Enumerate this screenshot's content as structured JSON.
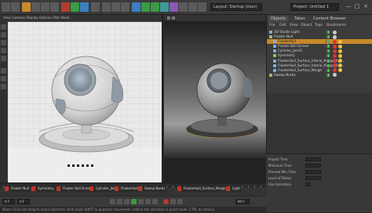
{
  "toolbar": {
    "layout_label": "Layout:",
    "layout_value": "Startup (User)",
    "project_label": "Project:",
    "project_value": "Untitled 1",
    "window_controls": [
      "—",
      "□",
      "×"
    ]
  },
  "left_viewport": {
    "menu": "View  Cameras  Display  Options  Filter  Panel",
    "camera_label": "Perspective"
  },
  "objects_panel": {
    "tabs": [
      "Objects",
      "Takes",
      "Content Browser"
    ],
    "menu": [
      "File",
      "Edit",
      "View",
      "Object",
      "Tags",
      "Bookmarks"
    ],
    "rows": [
      {
        "label": "3D Studio Light",
        "color": "#7ab3e0",
        "indent": 0,
        "selected": false,
        "mats": [
          "#cccccc"
        ]
      },
      {
        "label": "Floater Null",
        "color": "#9ac06a",
        "indent": 0,
        "selected": false,
        "mats": [
          "#cccccc"
        ]
      },
      {
        "label": "FloaterHull",
        "color": "#7ab3e0",
        "indent": 1,
        "selected": true,
        "mats": [
          "#d73a2e",
          "#f0c040"
        ]
      },
      {
        "label": "Floater Ball Screen",
        "color": "#7ab3e0",
        "indent": 1,
        "selected": false,
        "mats": [
          "#d73a2e",
          "#f0c040"
        ]
      },
      {
        "label": "Cylinder_Joint1",
        "color": "#7ab3e0",
        "indent": 1,
        "selected": false,
        "mats": [
          "#d73a2e",
          "#f0c040"
        ]
      },
      {
        "label": "Symmetry",
        "color": "#9ac06a",
        "indent": 1,
        "selected": false,
        "mats": [
          "#d73a2e",
          "#f0c040"
        ]
      },
      {
        "label": "FloaterHull_Surface_Interio_Merge_9_F...",
        "color": "#7ab3e0",
        "indent": 1,
        "selected": false,
        "mats": [
          "#d73a2e",
          "#f0c040"
        ]
      },
      {
        "label": "FloaterHull_Surface_Interio_Merge_9_P...",
        "color": "#7ab3e0",
        "indent": 1,
        "selected": false,
        "mats": [
          "#d73a2e",
          "#f0c040"
        ]
      },
      {
        "label": "FloaterHull_Surface_Merge",
        "color": "#7ab3e0",
        "indent": 1,
        "selected": false,
        "mats": [
          "#d73a2e",
          "#f0c040"
        ]
      },
      {
        "label": "Sweep Nurbs",
        "color": "#9ac06a",
        "indent": 0,
        "selected": false,
        "mats": [
          "#cccccc"
        ]
      }
    ]
  },
  "attributes_panel": {
    "rows": [
      "Project Time",
      "Minimum Time",
      "Preview Min Time",
      "Level of Detail",
      "Use Animation"
    ]
  },
  "timeline": {
    "markers": [
      {
        "label": "Floater Null"
      },
      {
        "label": "Symmetry"
      },
      {
        "label": "Floater Ball Screen"
      },
      {
        "label": "Cylinder_Joint1"
      },
      {
        "label": "FloaterHull"
      },
      {
        "label": "Sweep Nurbs"
      },
      {
        "label": "FloaterHull_Surface_Merge"
      },
      {
        "label": "Light"
      }
    ],
    "frame_start": "0 F",
    "frame_current": "0 F",
    "frame_end": "90 F",
    "status": "Move: Click and drag to move elements. Hold down SHIFT to quantize movement / add to the selection in point mode, CTRL to remove."
  }
}
